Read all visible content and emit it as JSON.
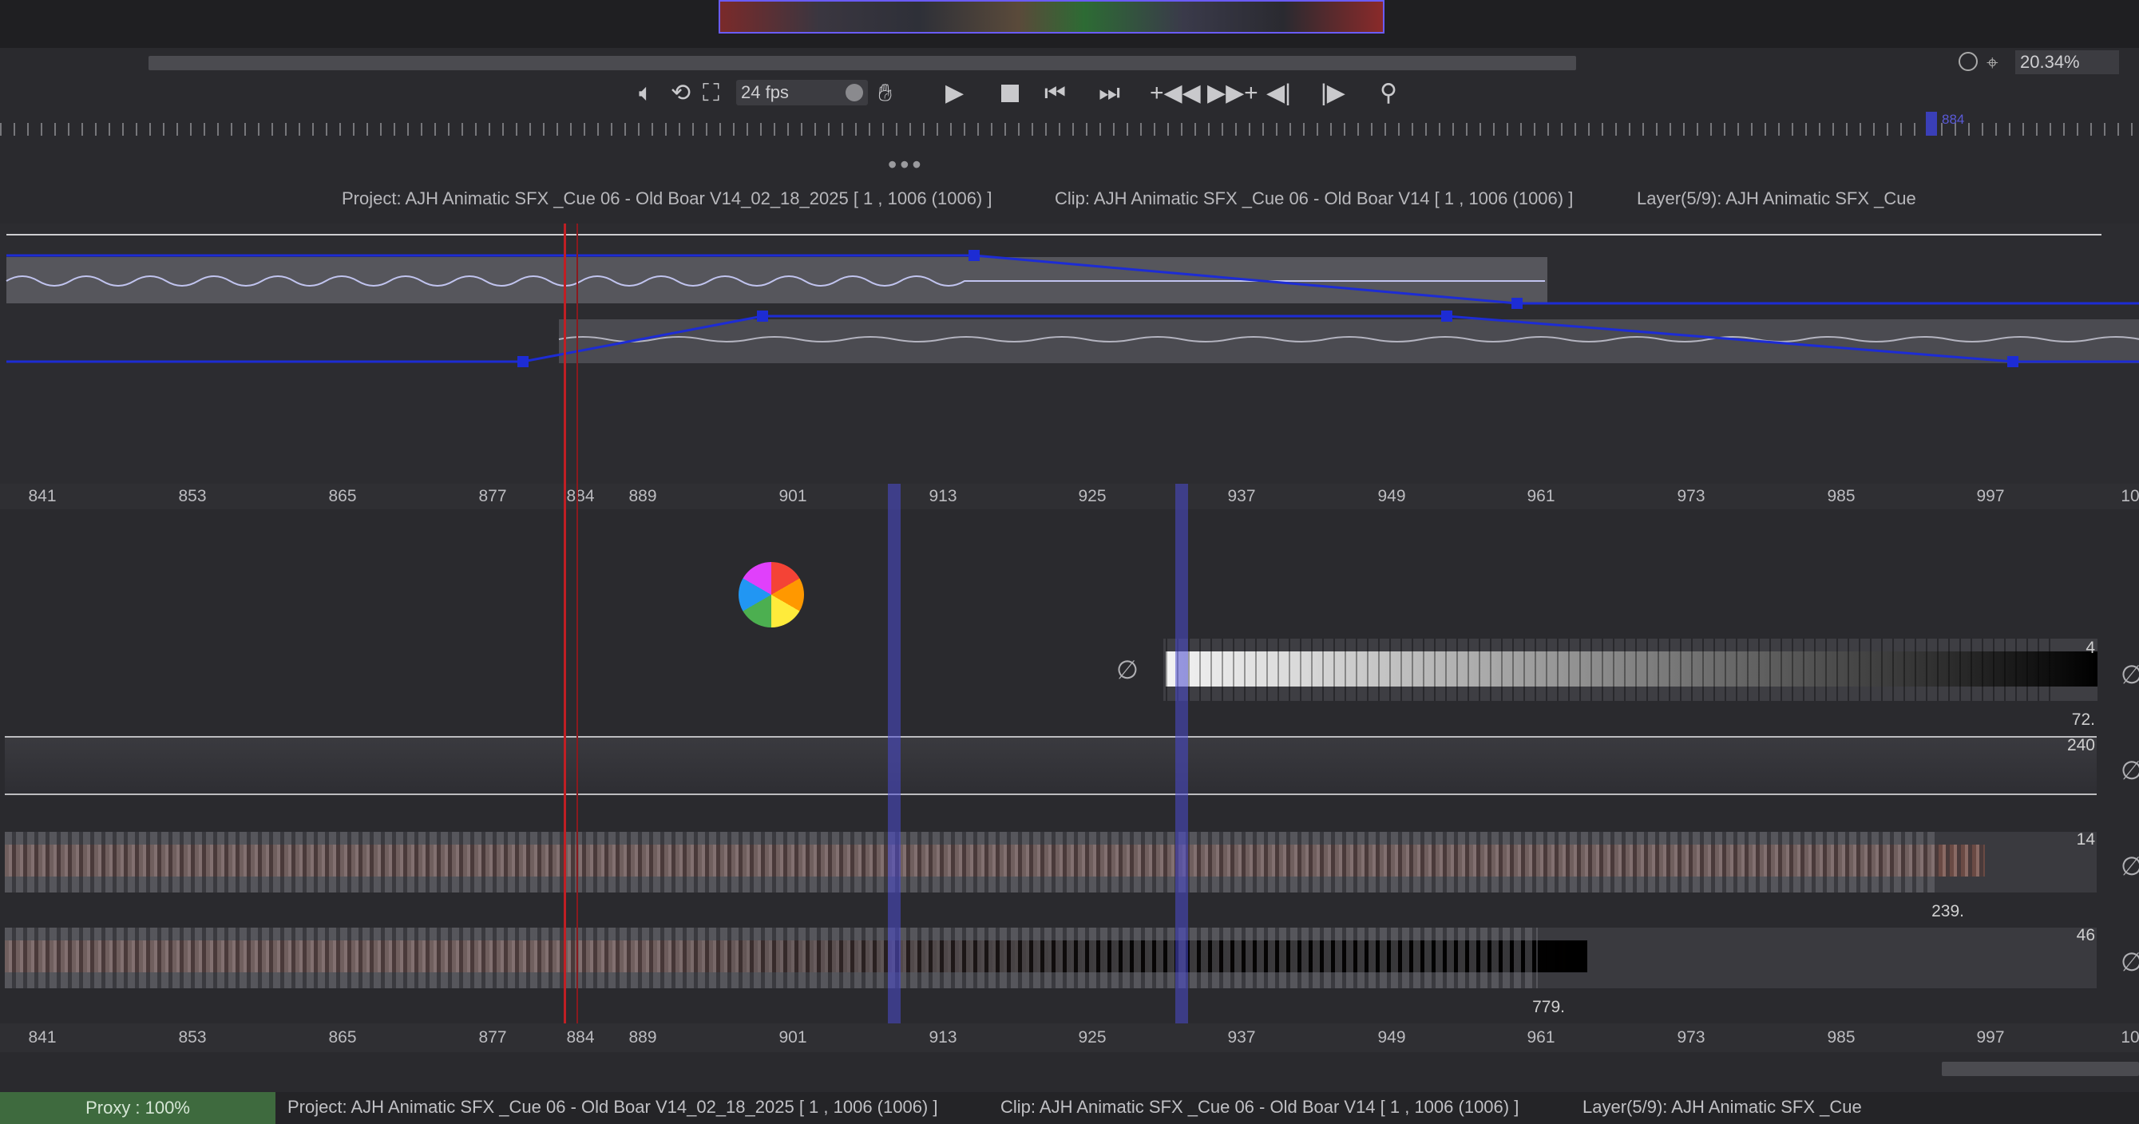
{
  "playback": {
    "fps": "24 fps",
    "zoom": "20.34%"
  },
  "header_info": {
    "project": "Project: AJH Animatic SFX _Cue 06 - Old Boar V14_02_18_2025 [ 1 , 1006  (1006) ]",
    "clip": "Clip: AJH Animatic SFX _Cue 06 - Old Boar V14 [ 1 , 1006  (1006) ]",
    "layer": "Layer(5/9): AJH Animatic SFX _Cue"
  },
  "ruler": {
    "labels": [
      "841",
      "853",
      "865",
      "877",
      "884",
      "889",
      "901",
      "913",
      "925",
      "937",
      "949",
      "961",
      "973",
      "985",
      "997",
      "10"
    ],
    "top_ticker_number": "884"
  },
  "tracks": {
    "gradient_track": {
      "top_value": "4",
      "bottom_value": "72."
    },
    "empty_track": {
      "top_value": "240"
    },
    "video_track_1": {
      "top_value": "14",
      "bottom_value": "239."
    },
    "video_track_2": {
      "top_value": "46",
      "bottom_value": "779."
    }
  },
  "status_bar": {
    "proxy": "Proxy : 100%",
    "project": "Project: AJH Animatic SFX _Cue 06 - Old Boar V14_02_18_2025 [ 1 , 1006  (1006) ]",
    "clip": "Clip: AJH Animatic SFX _Cue 06 - Old Boar V14 [ 1 , 1006  (1006) ]",
    "layer": "Layer(5/9): AJH Animatic SFX _Cue"
  },
  "colors": {
    "background": "#2a2a2e",
    "playhead": "#c01f24",
    "keyframe_blue": "#1d2cd4",
    "marker_blue": "#4a4ad0",
    "proxy_green": "#3e6a3e"
  }
}
